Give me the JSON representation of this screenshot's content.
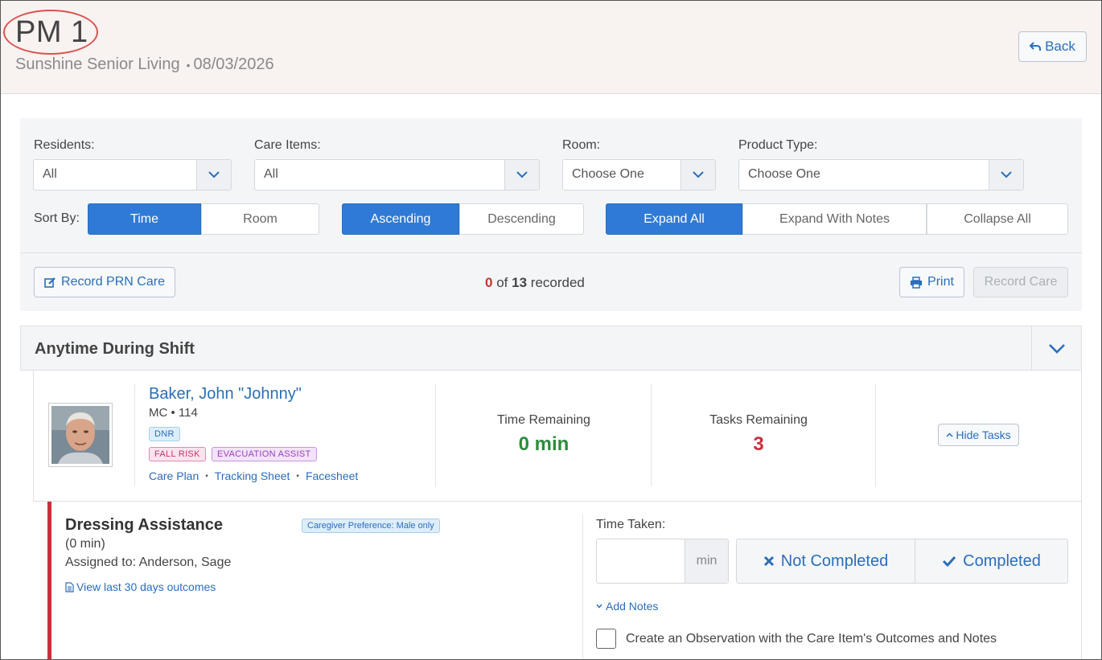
{
  "header": {
    "shift_title": "PM 1",
    "facility": "Sunshine Senior Living",
    "date": "08/03/2026",
    "back_label": "Back"
  },
  "filters": {
    "residents": {
      "label": "Residents:",
      "value": "All"
    },
    "care_items": {
      "label": "Care Items:",
      "value": "All"
    },
    "room": {
      "label": "Room:",
      "value": "Choose One"
    },
    "product_type": {
      "label": "Product Type:",
      "value": "Choose One"
    },
    "sort_by_label": "Sort By:",
    "sort_field": {
      "options": [
        "Time",
        "Room"
      ],
      "selected": "Time"
    },
    "sort_order": {
      "options": [
        "Ascending",
        "Descending"
      ],
      "selected": "Ascending"
    },
    "expand": {
      "options": [
        "Expand All",
        "Expand With Notes",
        "Collapse All"
      ],
      "selected": "Expand All"
    }
  },
  "toolbar": {
    "record_prn_label": "Record PRN Care",
    "recorded_count": "0",
    "recorded_of": "of",
    "recorded_total": "13",
    "recorded_suffix": "recorded",
    "print_label": "Print",
    "record_care_label": "Record Care"
  },
  "section": {
    "title": "Anytime During Shift"
  },
  "resident": {
    "name": "Baker, John \"Johnny\"",
    "unit": "MC",
    "room": "114",
    "badges": [
      "DNR",
      "FALL RISK",
      "EVACUATION ASSIST"
    ],
    "links": [
      "Care Plan",
      "Tracking Sheet",
      "Facesheet"
    ],
    "time_remaining_label": "Time Remaining",
    "time_remaining_value": "0 min",
    "tasks_remaining_label": "Tasks Remaining",
    "tasks_remaining_value": "3",
    "hide_tasks_label": "Hide Tasks",
    "colors": {
      "time_value": "#2e8b3a",
      "tasks_value": "#c9303c"
    }
  },
  "task": {
    "title": "Dressing Assistance",
    "duration": "(0 min)",
    "assigned": "Assigned to: Anderson, Sage",
    "history_link": "View last 30 days outcomes",
    "preference_badge": "Caregiver Preference: Male only",
    "time_taken_label": "Time Taken:",
    "time_taken_value": "",
    "time_unit": "min",
    "not_completed_label": "Not Completed",
    "completed_label": "Completed",
    "add_notes_label": "Add Notes",
    "observation_label": "Create an Observation with the Care Item's Outcomes and Notes",
    "observation_checked": false
  },
  "colors": {
    "accent": "#2f7ad6",
    "link": "#2a6ebb",
    "alert": "#c9303c",
    "header_bg": "#f8f2f1"
  },
  "icons": [
    "back-arrow-icon",
    "chevron-down-icon",
    "edit-icon",
    "print-icon",
    "chevron-up-icon",
    "document-icon",
    "times-icon",
    "check-icon"
  ]
}
